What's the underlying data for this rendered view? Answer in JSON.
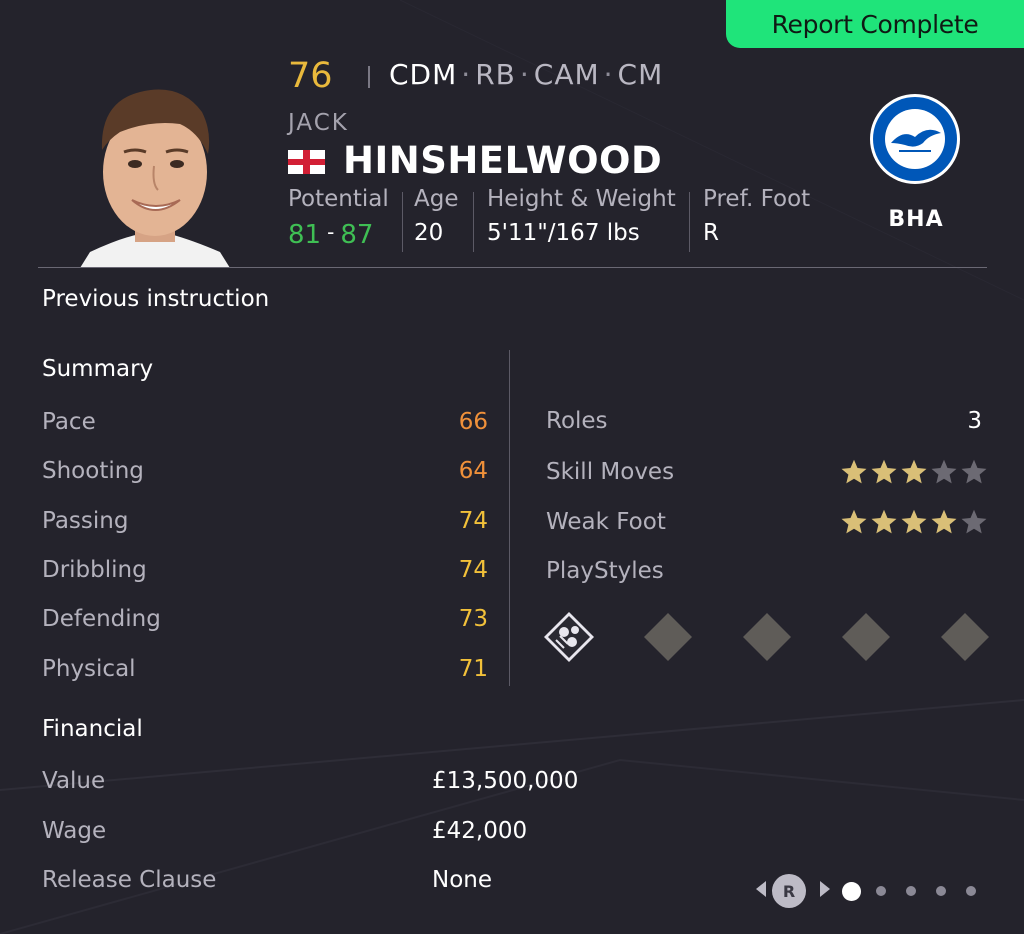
{
  "report_badge": "Report Complete",
  "player": {
    "overall": "76",
    "positions": [
      "CDM",
      "RB",
      "CAM",
      "CM"
    ],
    "first_name": "JACK",
    "last_name": "HINSHELWOOD",
    "nationality_flag": "england-flag-icon",
    "stats": {
      "potential_label": "Potential",
      "potential_low": "81",
      "potential_sep": "-",
      "potential_high": "87",
      "age_label": "Age",
      "age": "20",
      "hw_label": "Height & Weight",
      "hw": "5'11\"/167 lbs",
      "foot_label": "Pref. Foot",
      "foot": "R"
    },
    "club_abbr": "BHA",
    "club_crest": "brighton-crest-icon"
  },
  "previous_instruction": "Previous instruction",
  "summary": {
    "title": "Summary",
    "attributes": [
      {
        "name": "Pace",
        "value": "66",
        "color": "#f0913a"
      },
      {
        "name": "Shooting",
        "value": "64",
        "color": "#f0913a"
      },
      {
        "name": "Passing",
        "value": "74",
        "color": "#f2c13a"
      },
      {
        "name": "Dribbling",
        "value": "74",
        "color": "#f2c13a"
      },
      {
        "name": "Defending",
        "value": "73",
        "color": "#f2c13a"
      },
      {
        "name": "Physical",
        "value": "71",
        "color": "#f2c13a"
      }
    ],
    "roles_label": "Roles",
    "roles_value": "3",
    "skill_moves_label": "Skill Moves",
    "skill_moves_stars": 3,
    "weak_foot_label": "Weak Foot",
    "weak_foot_stars": 4,
    "max_stars": 5,
    "playstyles_label": "PlayStyles",
    "playstyles": [
      "playstyle-icon",
      "empty-slot",
      "empty-slot",
      "empty-slot",
      "empty-slot"
    ]
  },
  "financial": {
    "title": "Financial",
    "rows": [
      {
        "name": "Value",
        "value": "£13,500,000"
      },
      {
        "name": "Wage",
        "value": "£42,000"
      },
      {
        "name": "Release Clause",
        "value": "None"
      }
    ]
  },
  "pager": {
    "button_label": "R",
    "pages": 5,
    "active": 0
  },
  "colors": {
    "accent_green": "#1fe47a",
    "overall_gold": "#e9b93c",
    "potential_green": "#3fbf54",
    "star_filled": "#d9bf77",
    "star_empty": "#6c6a73"
  }
}
